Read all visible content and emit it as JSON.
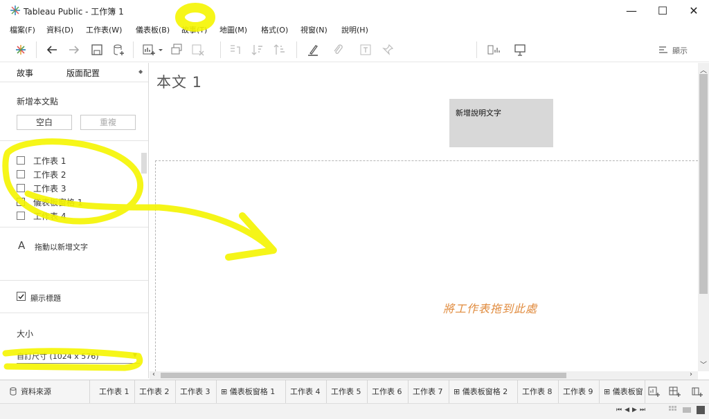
{
  "window": {
    "title": "Tableau Public - 工作簿 1",
    "minimize": "—",
    "maximize": "☐",
    "close": "✕"
  },
  "menu": [
    "檔案(F)",
    "資料(D)",
    "工作表(W)",
    "儀表板(B)",
    "故事(T)",
    "地圖(M)",
    "格式(O)",
    "視窗(N)",
    "說明(H)"
  ],
  "toolbar": {
    "show_me": "顯示"
  },
  "left_pane": {
    "tabs": [
      "故事",
      "版面配置"
    ],
    "new_story_point_label": "新增本文點",
    "blank_button": "空白",
    "duplicate_button": "重複",
    "sheets": [
      {
        "label": "工作表 1",
        "icon": "worksheet-icon"
      },
      {
        "label": "工作表 2",
        "icon": "worksheet-icon"
      },
      {
        "label": "工作表 3",
        "icon": "worksheet-icon"
      },
      {
        "label": "儀表板窗格 1",
        "icon": "dashboard-icon"
      },
      {
        "label": "工作表 4",
        "icon": "worksheet-icon"
      }
    ],
    "drag_text_label": "拖動以新增文字",
    "drag_text_icon": "A",
    "show_title_label": "顯示標題",
    "show_title_checked": true,
    "size_label": "大小",
    "size_value": "自訂尺寸 (1024 x 576)"
  },
  "canvas": {
    "story_title": "本文 1",
    "caption_text": "新增說明文字",
    "drop_hint": "將工作表拖到此處"
  },
  "bottom_tabs": {
    "data_source": "資料來源",
    "tabs": [
      "工作表 1",
      "工作表 2",
      "工作表 3",
      "儀表板窗格 1",
      "工作表 4",
      "工作表 5",
      "工作表 6",
      "工作表 7",
      "儀表板窗格 2",
      "工作表 8",
      "工作表 9",
      "儀表板窗"
    ]
  },
  "highlight_color": "#f5f500"
}
